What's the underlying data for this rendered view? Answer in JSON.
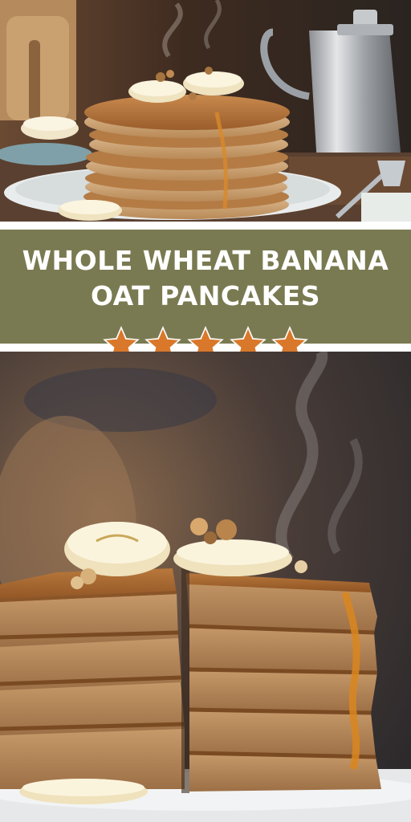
{
  "title": {
    "line1": "WHOLE WHEAT BANANA",
    "line2": "OAT PANCAKES"
  },
  "rating": {
    "stars": 5,
    "max": 5,
    "star_color": "#d9782a"
  },
  "colors": {
    "title_band": "#7a7a52",
    "title_text": "#ffffff"
  }
}
